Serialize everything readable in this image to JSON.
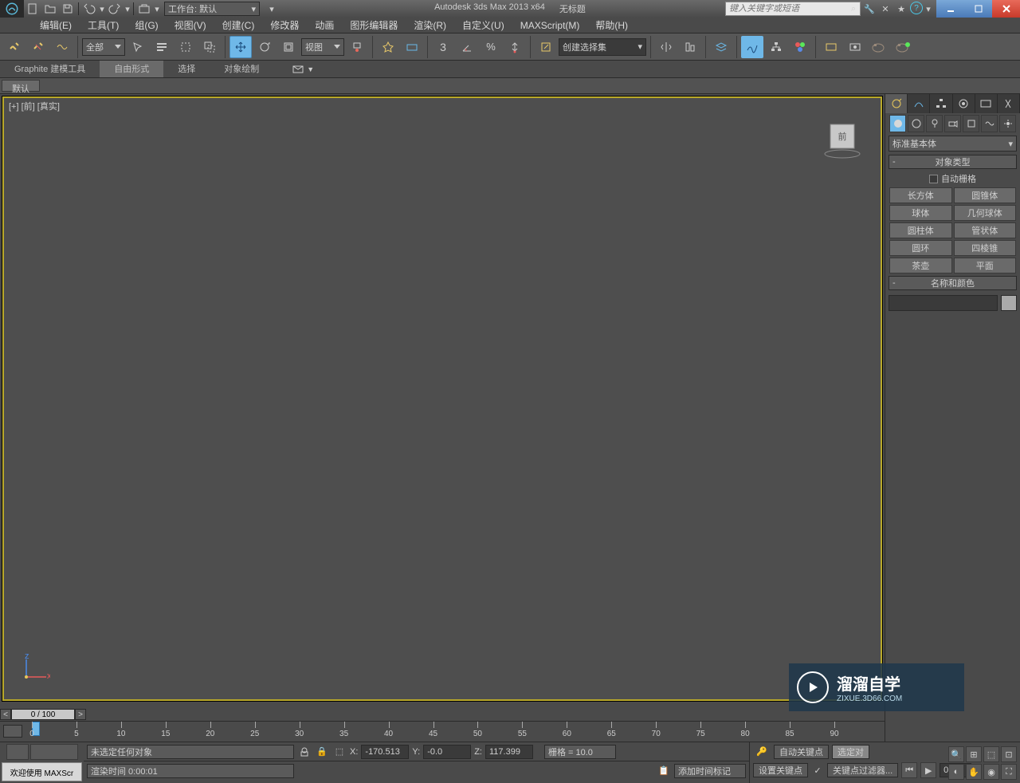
{
  "title": {
    "app": "Autodesk 3ds Max  2013 x64",
    "doc": "无标题"
  },
  "workspace_label": "工作台: 默认",
  "search_placeholder": "键入关键字或短语",
  "menus": [
    "编辑(E)",
    "工具(T)",
    "组(G)",
    "视图(V)",
    "创建(C)",
    "修改器",
    "动画",
    "图形编辑器",
    "渲染(R)",
    "自定义(U)",
    "MAXScript(M)",
    "帮助(H)"
  ],
  "filter_combo": "全部",
  "refcoord_combo": "视图",
  "snap_label": "3",
  "sel_set": "创建选择集",
  "ribbon": {
    "tabs": [
      "Graphite 建模工具",
      "自由形式",
      "选择",
      "对象绘制"
    ],
    "active": 1,
    "sub": [
      "默认"
    ]
  },
  "viewport": {
    "label": "[+] [前] [真实]",
    "cube": "前"
  },
  "right": {
    "dropdown": "标准基本体",
    "rollout_obj": "对象类型",
    "autogrid": "自动栅格",
    "objects": [
      "长方体",
      "圆锥体",
      "球体",
      "几何球体",
      "圆柱体",
      "管状体",
      "圆环",
      "四棱锥",
      "茶壶",
      "平面"
    ],
    "rollout_name": "名称和颜色"
  },
  "timeline": {
    "slider": "0 / 100",
    "ticks": [
      0,
      5,
      10,
      15,
      20,
      25,
      30,
      35,
      40,
      45,
      50,
      55,
      60,
      65,
      70,
      75,
      80,
      85,
      90
    ]
  },
  "status": {
    "script": "欢迎使用  MAXScr",
    "none_sel": "未选定任何对象",
    "render": "渲染时间  0:00:01",
    "x": "-170.513",
    "y": "-0.0",
    "z": "117.399",
    "grid": "栅格 = 10.0",
    "addtag": "添加时间标记",
    "autokey": "自动关键点",
    "setkey": "设置关键点",
    "selset2": "选定对",
    "keyfilter": "关键点过滤器...",
    "frame": "0"
  },
  "watermark": {
    "t1": "溜溜自学",
    "t2": "ZIXUE.3D66.COM"
  }
}
